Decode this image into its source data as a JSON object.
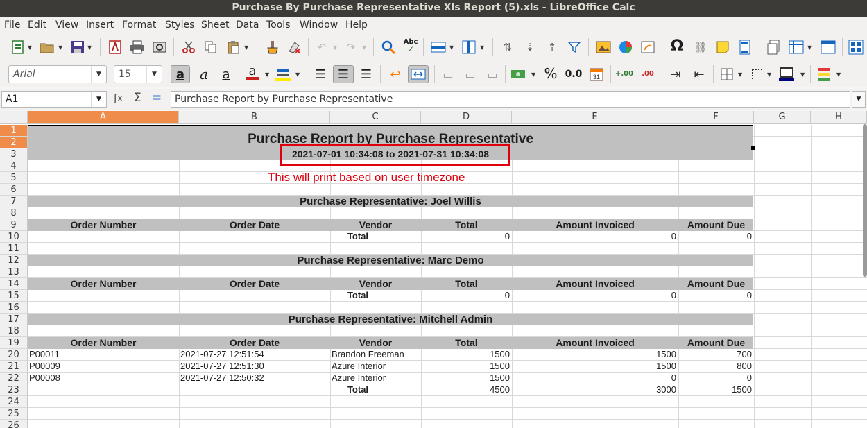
{
  "window": {
    "title": "Purchase By Purchase Representative Xls Report (5).xls - LibreOffice Calc"
  },
  "menu": [
    "File",
    "Edit",
    "View",
    "Insert",
    "Format",
    "Styles",
    "Sheet",
    "Data",
    "Tools",
    "Window",
    "Help"
  ],
  "toolbar": {
    "font_name": "Arial",
    "font_size": "15",
    "percent_label": "%",
    "decimal_label": "0.0",
    "add_decimal_label": "+.00",
    "del_decimal_label": ".00"
  },
  "formula_bar": {
    "cell_ref": "A1",
    "content": "Purchase Report by Purchase Representative"
  },
  "columns": [
    "A",
    "B",
    "C",
    "D",
    "E",
    "F",
    "G",
    "H"
  ],
  "rows": [
    "1",
    "2",
    "3",
    "4",
    "5",
    "6",
    "7",
    "8",
    "9",
    "10",
    "11",
    "12",
    "13",
    "14",
    "15",
    "16",
    "17",
    "18",
    "19",
    "20",
    "21",
    "22",
    "23",
    "24",
    "25",
    "26"
  ],
  "sheet": {
    "title": "Purchase Report by Purchase Representative",
    "date_range": "2021-07-01 10:34:08 to 2021-07-31 10:34:08",
    "annotation": "This will print based on user timezone",
    "table_headers": [
      "Order Number",
      "Order Date",
      "Vendor",
      "Total",
      "Amount Invoiced",
      "Amount Due"
    ],
    "total_label": "Total",
    "reps": [
      {
        "heading": "Purchase Representative: Joel Willis",
        "orders": [],
        "totals": {
          "total": "0",
          "invoiced": "0",
          "due": "0"
        }
      },
      {
        "heading": "Purchase Representative: Marc Demo",
        "orders": [],
        "totals": {
          "total": "0",
          "invoiced": "0",
          "due": "0"
        }
      },
      {
        "heading": "Purchase Representative: Mitchell Admin",
        "orders": [
          {
            "number": "P00011",
            "date": "2021-07-27 12:51:54",
            "vendor": "Brandon Freeman",
            "total": "1500",
            "invoiced": "1500",
            "due": "700"
          },
          {
            "number": "P00009",
            "date": "2021-07-27 12:51:30",
            "vendor": "Azure Interior",
            "total": "1500",
            "invoiced": "1500",
            "due": "800"
          },
          {
            "number": "P00008",
            "date": "2021-07-27 12:50:32",
            "vendor": "Azure Interior",
            "total": "1500",
            "invoiced": "0",
            "due": "0"
          }
        ],
        "totals": {
          "total": "4500",
          "invoiced": "3000",
          "due": "1500"
        }
      }
    ]
  },
  "colors": {
    "annotation_red": "#e0000d",
    "header_gray": "#c0c0c0",
    "selection_orange": "#f08c4a"
  }
}
